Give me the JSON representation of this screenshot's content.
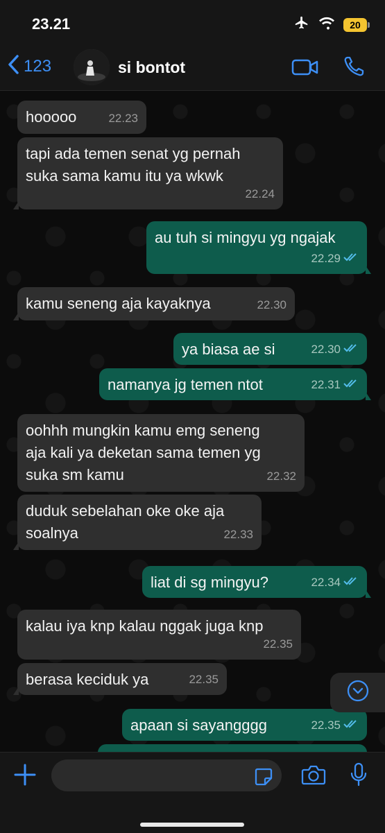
{
  "status_bar": {
    "time": "23.21",
    "battery": "20"
  },
  "header": {
    "back_label": "123",
    "contact_name": "si bontot"
  },
  "messages": [
    {
      "dir": "in",
      "text": "hooooo",
      "time": "22.23"
    },
    {
      "dir": "in",
      "text": "tapi ada temen senat yg pernah\nsuka sama kamu itu ya wkwk",
      "time": "22.24"
    },
    {
      "dir": "out",
      "text": "au tuh si mingyu yg ngajak",
      "time": "22.29"
    },
    {
      "dir": "in",
      "text": "kamu seneng aja kayaknya",
      "time": "22.30"
    },
    {
      "dir": "out",
      "text": "ya biasa ae si",
      "time": "22.30"
    },
    {
      "dir": "out",
      "text": "namanya jg temen ntot",
      "time": "22.31"
    },
    {
      "dir": "in",
      "text": "oohhh mungkin kamu emg seneng\naja kali ya deketan sama temen yg\nsuka sm kamu",
      "time": "22.32"
    },
    {
      "dir": "in",
      "text": "duduk sebelahan oke oke aja\nsoalnya",
      "time": "22.33"
    },
    {
      "dir": "out",
      "text": "liat di sg mingyu?",
      "time": "22.34"
    },
    {
      "dir": "in",
      "text": "kalau iya knp kalau nggak juga knp",
      "time": "22.35"
    },
    {
      "dir": "in",
      "text": "berasa keciduk ya",
      "time": "22.35"
    },
    {
      "dir": "out",
      "text": "apaan si sayangggg",
      "time": "22.35"
    },
    {
      "dir": "out",
      "text": "",
      "time": ""
    }
  ],
  "input": {
    "placeholder": ""
  },
  "colors": {
    "accent": "#3d8ff5",
    "outgoing": "#0e5c4c",
    "incoming": "#2f2f2f",
    "read_tick": "#53bdeb"
  },
  "icons": [
    "chevron-left-icon",
    "video-call-icon",
    "phone-icon",
    "chevron-down-icon",
    "plus-icon",
    "sticker-icon",
    "camera-icon",
    "mic-icon"
  ]
}
